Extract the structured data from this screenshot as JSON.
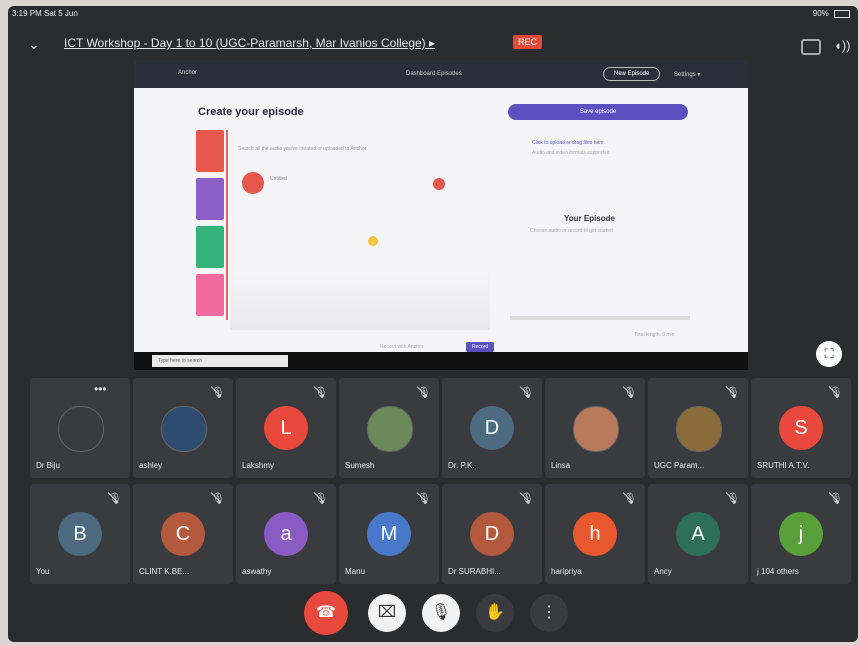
{
  "status_bar": {
    "time": "3:19 PM Sat 5 Jun",
    "battery": "90%"
  },
  "meeting": {
    "title": "ICT Workshop - Day 1 to 10 (UGC-Paramarsh, Mar Ivanios College) ▸",
    "rec": "REC"
  },
  "screen_share": {
    "logo": "Anchor",
    "nav_links": "Dashboard  Episodes",
    "new_episode": "New Episode",
    "settings": "Settings ▾",
    "heading": "Create your episode",
    "hint": "Search all the audio you've created or uploaded to Anchor",
    "card_label": "Untitled",
    "save_button": "Save episode",
    "upload_hint": "Click to upload or drag files here",
    "upload_sub": "Audio and video formats supported",
    "your_episode": "Your Episode",
    "your_episode_sub": "Choose audio or record to get started",
    "estimated": "Total length: 0 min",
    "cta": "Record with Anchor",
    "record_button": "Record",
    "search_placeholder": "Type here to search",
    "progress": 0
  },
  "participants": [
    {
      "name": "Dr Biju",
      "initial": "",
      "color": "#3a3b3f",
      "photo": true,
      "muted": false,
      "more": "•••"
    },
    {
      "name": "ashley",
      "initial": "",
      "color": "#2d4b6e",
      "photo": true,
      "muted": true
    },
    {
      "name": "Lakshmy",
      "initial": "L",
      "color": "#e9483c",
      "photo": false,
      "muted": true
    },
    {
      "name": "Sumesh",
      "initial": "",
      "color": "#6b8a5a",
      "photo": true,
      "muted": true
    },
    {
      "name": "Dr. P.K.",
      "initial": "D",
      "color": "#4c6a80",
      "photo": false,
      "muted": true
    },
    {
      "name": "Linsa",
      "initial": "",
      "color": "#b87a5a",
      "photo": true,
      "muted": true
    },
    {
      "name": "UGC Param...",
      "initial": "",
      "color": "#8a6b3a",
      "photo": true,
      "muted": true
    },
    {
      "name": "SRUTHI A.T.V.",
      "initial": "S",
      "color": "#e9483c",
      "photo": false,
      "muted": true
    },
    {
      "name": "You",
      "initial": "B",
      "color": "#4c6a80",
      "photo": false,
      "muted": true
    },
    {
      "name": "CLINT K.BE...",
      "initial": "C",
      "color": "#b35a3e",
      "photo": false,
      "muted": true
    },
    {
      "name": "aswathy",
      "initial": "a",
      "color": "#8a5bc2",
      "photo": false,
      "muted": true
    },
    {
      "name": "Manu",
      "initial": "M",
      "color": "#4a78c9",
      "photo": false,
      "muted": true
    },
    {
      "name": "Dr SURABHI...",
      "initial": "D",
      "color": "#b35a3e",
      "photo": false,
      "muted": true
    },
    {
      "name": "haripriya",
      "initial": "h",
      "color": "#e8572e",
      "photo": false,
      "muted": true
    },
    {
      "name": "Ancy",
      "initial": "A",
      "color": "#2e6f5a",
      "photo": false,
      "muted": true
    },
    {
      "name": "j 104 others",
      "initial": "j",
      "color": "#5aa03a",
      "photo": false,
      "muted": true
    }
  ],
  "controls": {
    "end_call": "☎",
    "camera": "⌧",
    "mic": "🎙",
    "hand": "✋",
    "more": "⋮"
  },
  "icons": {
    "chevron": "chevron-down-icon",
    "camera_switch": "camera-icon",
    "speaker": "speaker-icon",
    "fullscreen": "fullscreen-icon",
    "mute": "mic-off-icon"
  }
}
